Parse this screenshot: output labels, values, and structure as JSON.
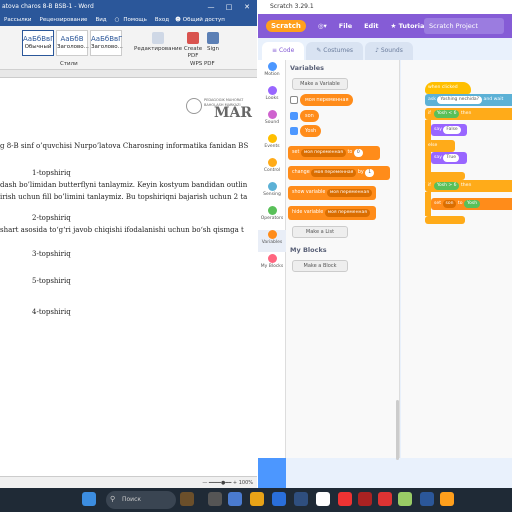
{
  "word": {
    "title": "atova charos 8-B BSB-1 - Word",
    "tabs": [
      "Рассылки",
      "Рецензирование",
      "Вид",
      "Помощь",
      "Вход",
      "Общий доступ"
    ],
    "styles": [
      {
        "preview": "АаБбВвГ",
        "name": "Обычный"
      },
      {
        "preview": "АаБбВ",
        "name": "Заголово..."
      },
      {
        "preview": "АаБбВвГ",
        "name": "Заголово..."
      }
    ],
    "styles_group": "Стили",
    "edit_btn": "Редактирование",
    "create_pdf": "Create PDF",
    "sign": "Sign",
    "wps_group": "WPS PDF",
    "logo_lines": [
      "PEDAGOGIK MAHORAT",
      "BAHOLASH MARKAZI"
    ],
    "logo_big": "MAR",
    "lines": [
      "g 8-B sinf o’quvchisi Nurpo’latova Charosning informatika fanidan BS",
      "1-topshiriq",
      "dash bo’limidan butterflyni tanlaymiz. Keyin kostyum bandidan outlin",
      "irish uchun fill bo’limini tanlaymiz. Bu topshiriqni bajarish uchun 2 ta",
      "2-topshiriq",
      "shart asosida to‘g‘ri javob chiqishi ifodalanishi uchun  bo‘sh qismga t",
      "3-topshiriq",
      "5-topshiriq",
      "4-topshiriq"
    ],
    "zoom": "100%"
  },
  "scratch": {
    "title": "Scratch 3.29.1",
    "logo": "Scratch",
    "menu": [
      "File",
      "Edit",
      "Tutorials"
    ],
    "project": "Scratch Project",
    "tabs": [
      "Code",
      "Costumes",
      "Sounds"
    ],
    "categories": [
      {
        "name": "Motion",
        "color": "#4c97ff"
      },
      {
        "name": "Looks",
        "color": "#9966ff"
      },
      {
        "name": "Sound",
        "color": "#cf63cf"
      },
      {
        "name": "Events",
        "color": "#ffbf00"
      },
      {
        "name": "Control",
        "color": "#ffab19"
      },
      {
        "name": "Sensing",
        "color": "#5cb1d6"
      },
      {
        "name": "Operators",
        "color": "#59c059"
      },
      {
        "name": "Variables",
        "color": "#ff8c1a"
      },
      {
        "name": "My Blocks",
        "color": "#ff6680"
      }
    ],
    "palette": {
      "variables_header": "Variables",
      "make_variable": "Make a Variable",
      "vars": [
        "моя переменная",
        "son",
        "Yosh"
      ],
      "set": "set",
      "set_var": "моя переменная",
      "set_to": "to",
      "set_val": "0",
      "change": "change",
      "change_var": "моя переменная",
      "change_by": "by",
      "change_val": "1",
      "show": "show variable",
      "show_var": "моя переменная",
      "hide": "hide variable",
      "hide_var": "моя переменная",
      "make_list": "Make a List",
      "myblocks_header": "My Blocks",
      "make_block": "Make a Block"
    },
    "script": {
      "when_clicked": "when clicked",
      "ask": "ask",
      "question": "Yoshing nechida?",
      "and_wait": "and wait",
      "if1": "if",
      "yosh1": "Yosh",
      "lt": "<",
      "n1": "6",
      "then": "then",
      "say1": "say",
      "false": "False",
      "else": "else",
      "say2": "say",
      "true": "True",
      "if2": "if",
      "yosh2": "Yosh",
      ">": ">",
      "n2": "6",
      "then2": "then",
      "set": "set",
      "son": "son",
      "to": "to",
      "yosh3": "Yosh"
    }
  },
  "taskbar": {
    "search": "Поиск"
  }
}
